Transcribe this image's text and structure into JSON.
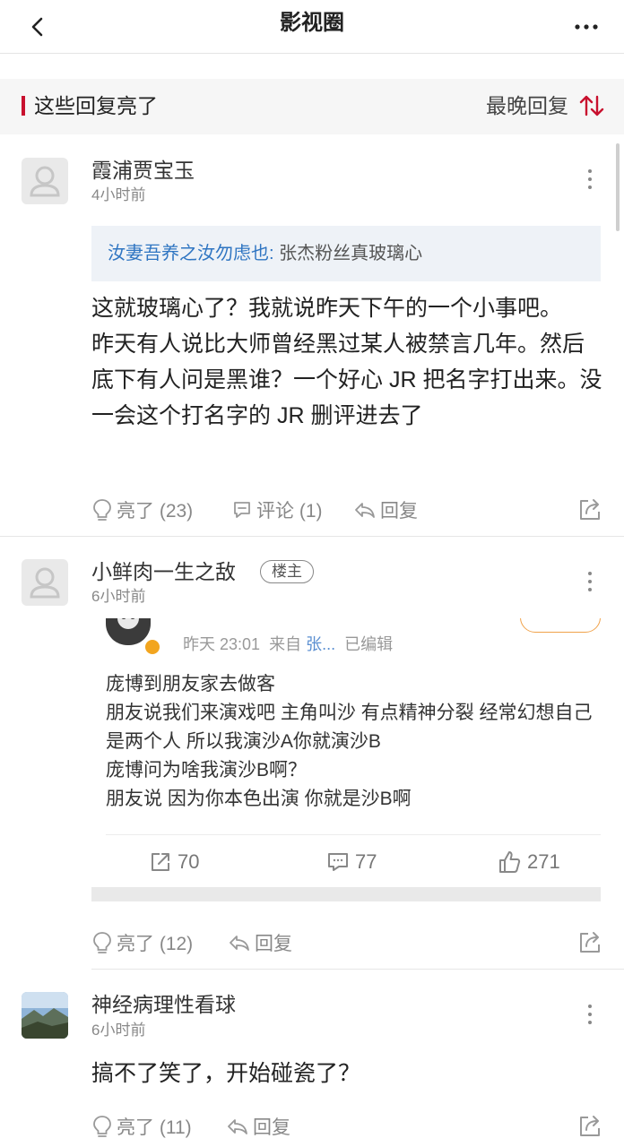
{
  "header": {
    "title": "影视圈",
    "back_icon": "chevron-left-icon",
    "more_icon": "more-horizontal-icon"
  },
  "section": {
    "label": "这些回复亮了",
    "sort_label": "最晚回复",
    "sort_icon": "sort-arrows-icon",
    "accent_color": "#c8102e"
  },
  "comments": [
    {
      "user": "霞浦贾宝玉",
      "time": "4小时前",
      "quote_user": "汝妻吾养之汝勿虑也:",
      "quote_text": " 张杰粉丝真玻璃心",
      "body": "这就玻璃心了？我就说昨天下午的一个小事吧。\n昨天有人说比大师曾经黑过某人被禁言几年。然后底下有人问是黑谁？一个好心 JR 把名字打出来。没一会这个打名字的 JR 删评进去了",
      "light_label": "亮了 (23)",
      "comment_label": "评论 (1)",
      "reply_label": "回复"
    },
    {
      "user": "小鲜肉一生之敌",
      "badge": "楼主",
      "time": "6小时前",
      "embed": {
        "time": "昨天 23:01",
        "source_prefix": "来自 ",
        "source": "张...",
        "edited": "已编辑",
        "text": "庞博到朋友家去做客\n朋友说我们来演戏吧 主角叫沙 有点精神分裂 经常幻想自己是两个人 所以我演沙A你就演沙B\n庞博问为啥我演沙B啊？\n朋友说 因为你本色出演 你就是沙B啊",
        "reposts": "70",
        "comments": "77",
        "likes": "271"
      },
      "light_label": "亮了 (12)",
      "reply_label": "回复"
    },
    {
      "user": "神经病理性看球",
      "time": "6小时前",
      "body": "搞不了笑了，开始碰瓷了？",
      "light_label": "亮了 (11)",
      "reply_label": "回复"
    }
  ]
}
